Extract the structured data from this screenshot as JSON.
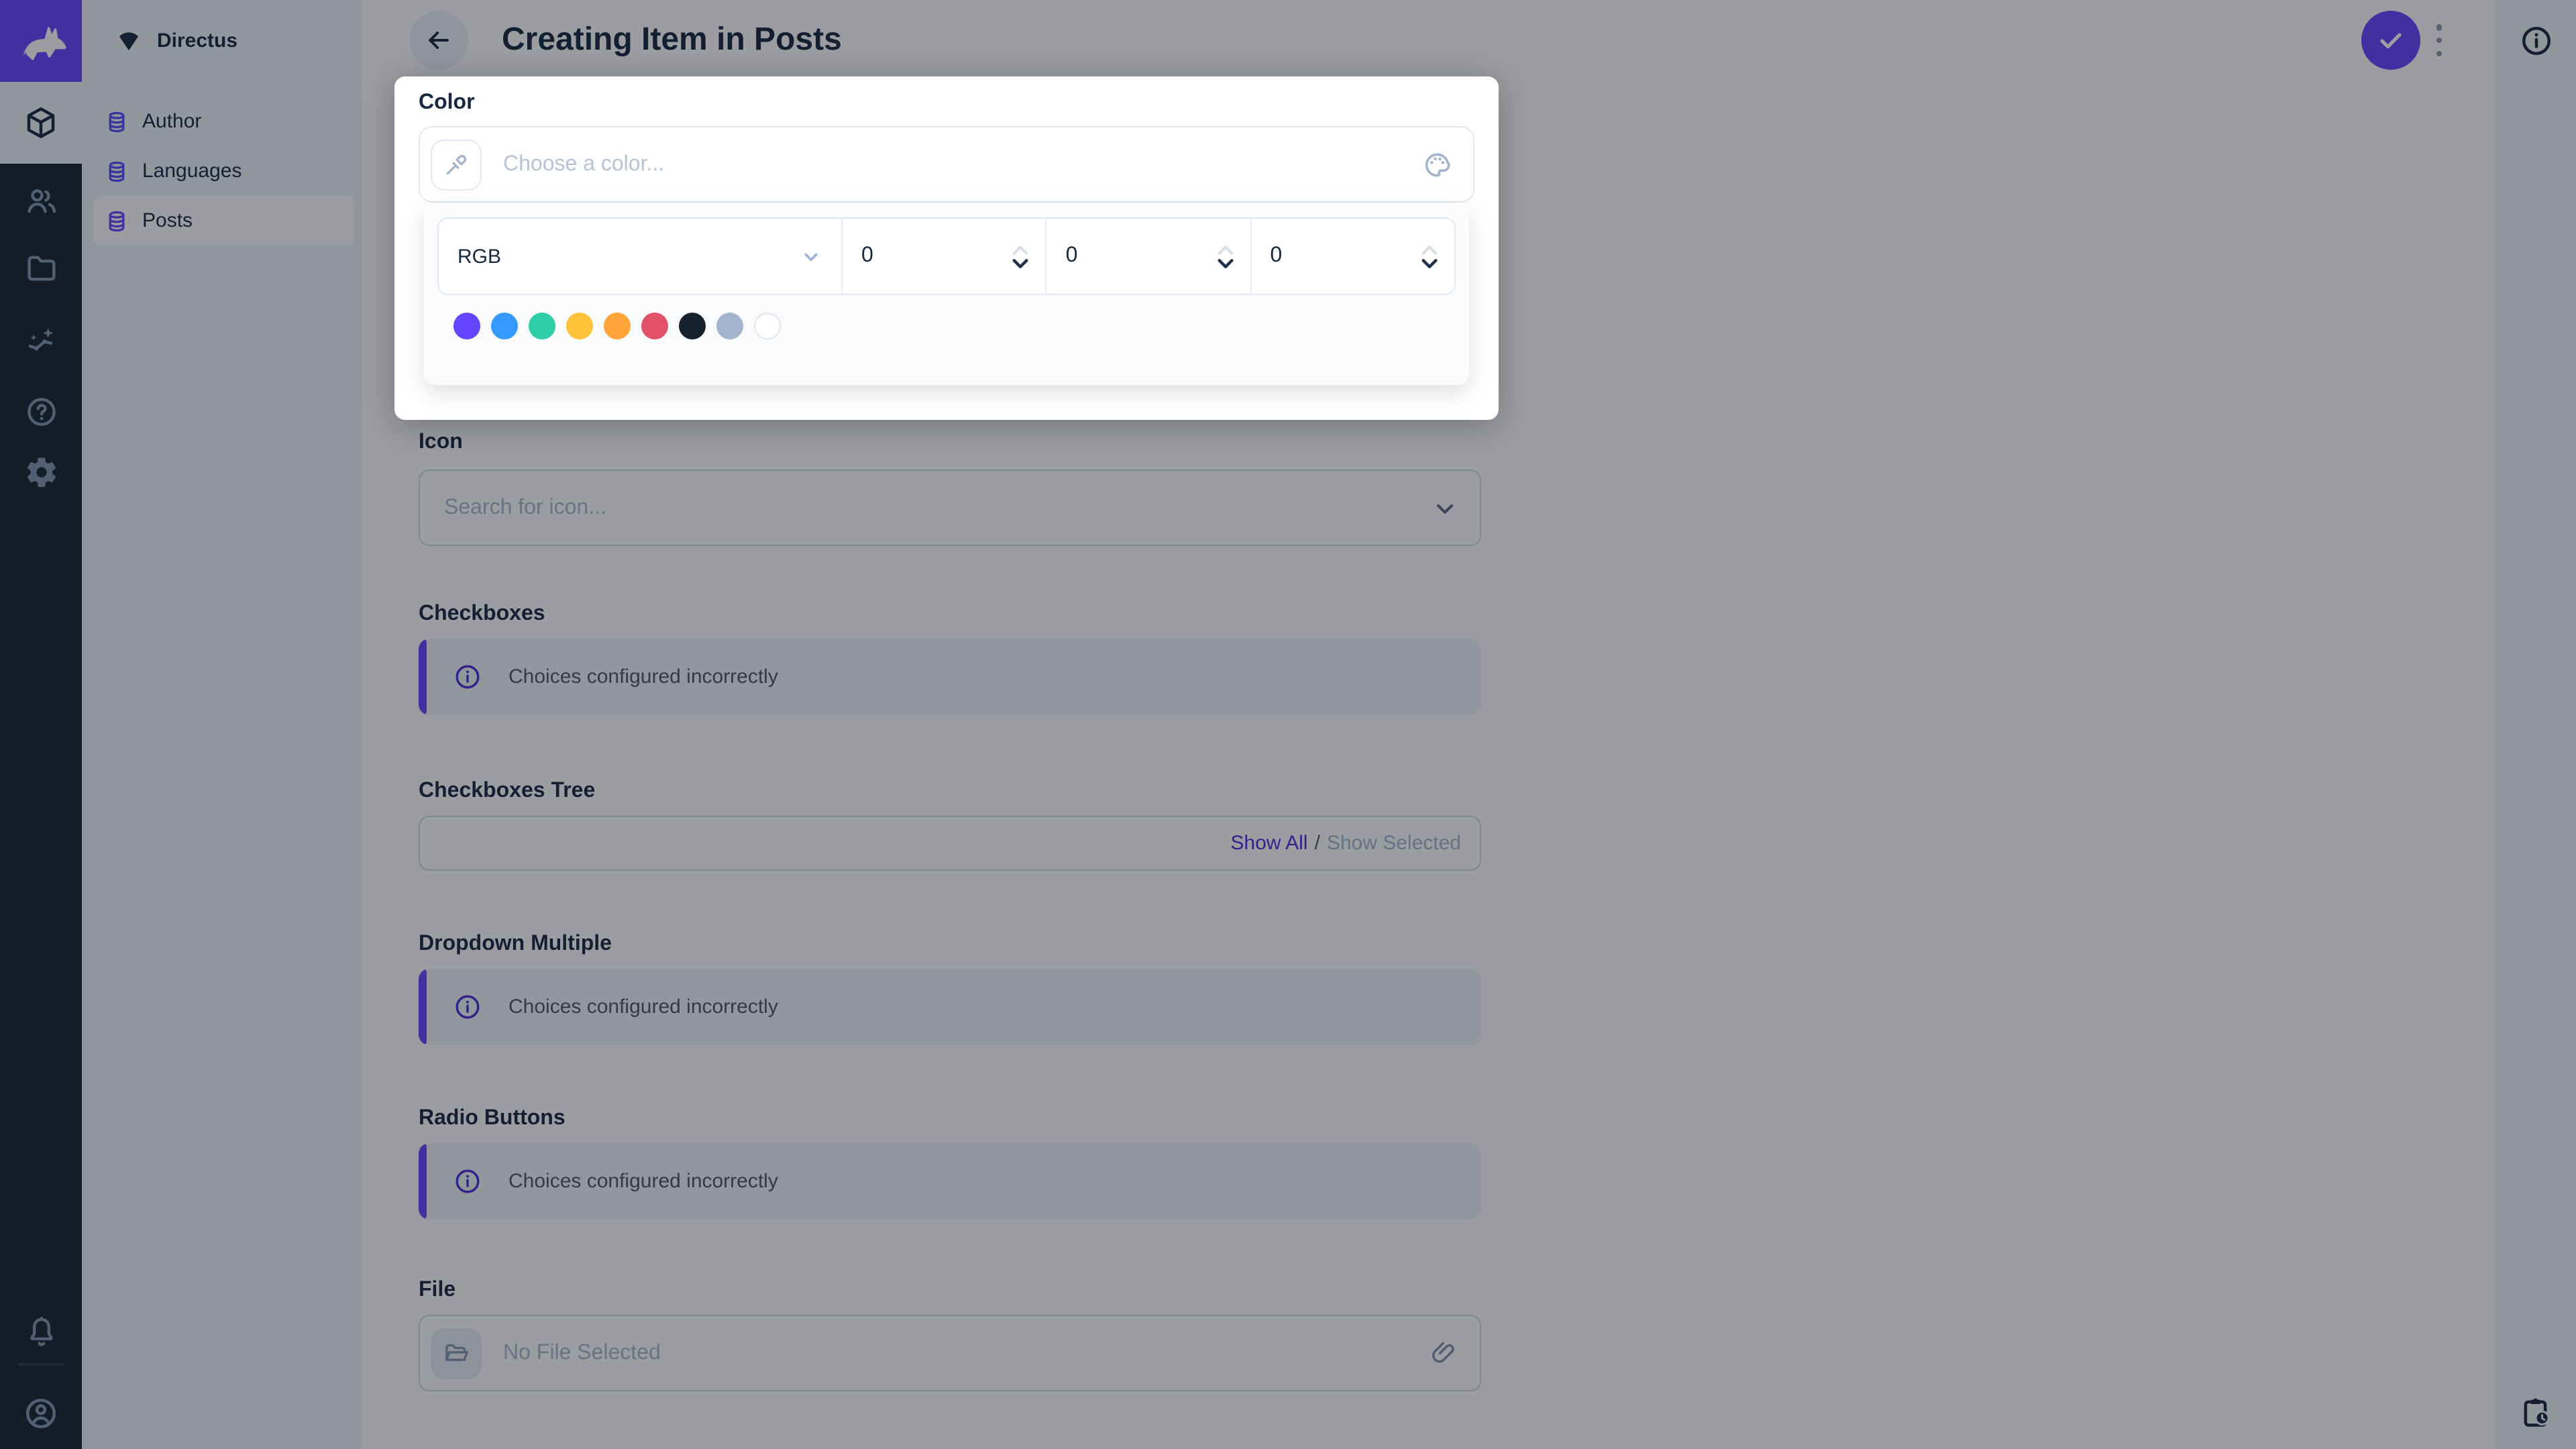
{
  "app": {
    "project_name": "Directus"
  },
  "colors": {
    "accent": "#6644FF",
    "module_bar_bg": "#18222F",
    "sidebar_bg": "#F0F4FA"
  },
  "module_bar": {
    "icons": [
      "directus-rabbit-logo",
      "content-module",
      "users-module",
      "files-module",
      "insights-module",
      "docs-module",
      "settings-module",
      "notifications-bell",
      "user-avatar"
    ]
  },
  "sidebar": {
    "items": [
      {
        "label": "Author",
        "active": false
      },
      {
        "label": "Languages",
        "active": false
      },
      {
        "label": "Posts",
        "active": true
      }
    ]
  },
  "header": {
    "title": "Creating Item in Posts"
  },
  "color_picker": {
    "label": "Color",
    "placeholder": "Choose a color...",
    "mode": "RGB",
    "values": [
      "0",
      "0",
      "0"
    ],
    "swatches": [
      "#6644FF",
      "#3399FF",
      "#2ECDA7",
      "#FFC23B",
      "#FFA439",
      "#E35169",
      "#18222F",
      "#A2B5CD",
      "#FFFFFF"
    ]
  },
  "fields": {
    "icon": {
      "label": "Icon",
      "placeholder": "Search for icon..."
    },
    "checkboxes": {
      "label": "Checkboxes",
      "notice": "Choices configured incorrectly"
    },
    "checkboxes_tree": {
      "label": "Checkboxes Tree",
      "show_all": "Show All",
      "separator": "/",
      "show_selected": "Show Selected"
    },
    "dropdown_multiple": {
      "label": "Dropdown Multiple",
      "notice": "Choices configured incorrectly"
    },
    "radio_buttons": {
      "label": "Radio Buttons",
      "notice": "Choices configured incorrectly"
    },
    "file": {
      "label": "File",
      "placeholder": "No File Selected"
    }
  }
}
